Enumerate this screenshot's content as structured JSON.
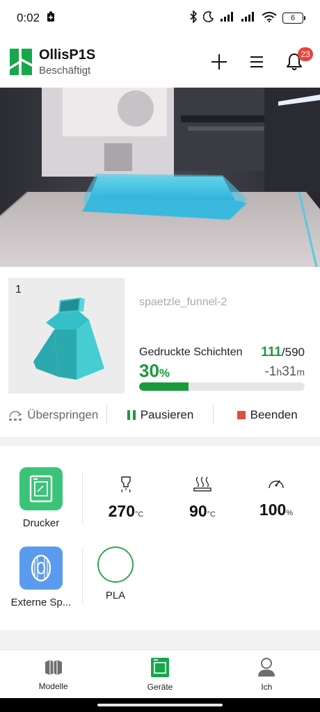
{
  "status_bar": {
    "time": "0:02",
    "battery": "6"
  },
  "header": {
    "printer_name": "OllisP1S",
    "printer_state": "Beschäftigt",
    "notification_count": "23"
  },
  "job": {
    "plate_number": "1",
    "file_name": "spaetzle_funnel-2",
    "layers_label": "Gedruckte Schichten",
    "layers_current": "111",
    "layers_total": "/590",
    "percent_value": "30",
    "percent_unit": "%",
    "remaining_prefix": "-1",
    "remaining_h": "h",
    "remaining_min": "31",
    "remaining_m": "m",
    "progress": 0.3,
    "skip_label": "Überspringen",
    "pause_label": "Pausieren",
    "stop_label": "Beenden"
  },
  "panel": {
    "printer_tile_label": "Drucker",
    "nozzle_temp": "270",
    "bed_temp": "90",
    "temp_unit": "°C",
    "speed": "100",
    "speed_unit": "%",
    "spool_tile_label": "Externe Sp...",
    "filament_type": "PLA"
  },
  "nav": {
    "models": "Modelle",
    "devices": "Geräte",
    "me": "Ich"
  },
  "colors": {
    "accent": "#1b9a3c",
    "stop": "#e24c43",
    "spool_tile": "#5b9bef",
    "printer_tile": "#3cc37a",
    "model": "#2ec4c9"
  }
}
